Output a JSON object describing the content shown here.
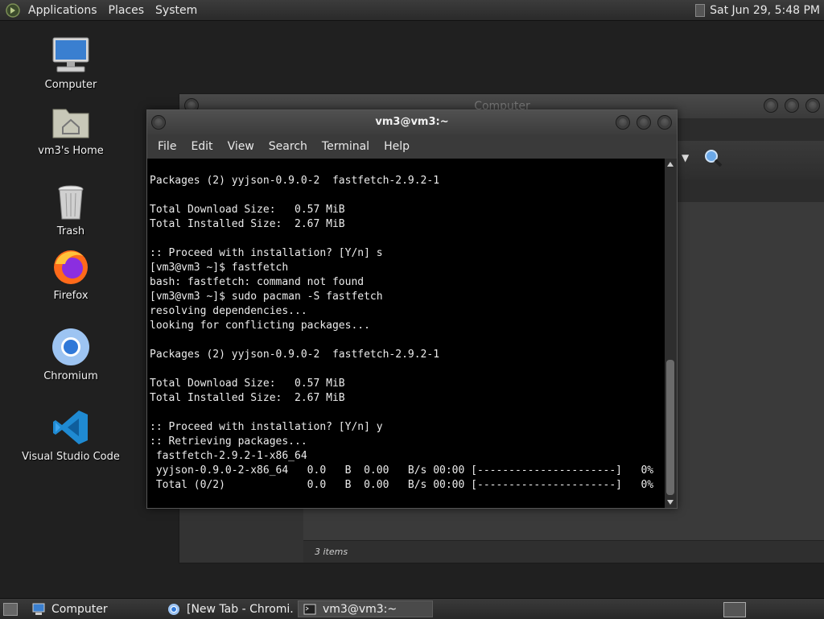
{
  "top_panel": {
    "menus": [
      "Applications",
      "Places",
      "System"
    ],
    "clock": "Sat Jun 29,  5:48 PM"
  },
  "desktop_icons": [
    {
      "label": "Computer",
      "icon": "computer-icon"
    },
    {
      "label": "vm3's Home",
      "icon": "home-folder-icon"
    },
    {
      "label": "Trash",
      "icon": "trash-icon"
    },
    {
      "label": "Firefox",
      "icon": "firefox-icon"
    },
    {
      "label": "Chromium",
      "icon": "chromium-icon"
    },
    {
      "label": "Visual Studio Code",
      "icon": "vscode-icon"
    }
  ],
  "file_manager": {
    "title": "Computer",
    "status": "3 items"
  },
  "terminal": {
    "title": "vm3@vm3:~",
    "menu": [
      "File",
      "Edit",
      "View",
      "Search",
      "Terminal",
      "Help"
    ],
    "lines": [
      "Packages (2) yyjson-0.9.0-2  fastfetch-2.9.2-1",
      "",
      "Total Download Size:   0.57 MiB",
      "Total Installed Size:  2.67 MiB",
      "",
      ":: Proceed with installation? [Y/n] s",
      "[vm3@vm3 ~]$ fastfetch",
      "bash: fastfetch: command not found",
      "[vm3@vm3 ~]$ sudo pacman -S fastfetch",
      "resolving dependencies...",
      "looking for conflicting packages...",
      "",
      "Packages (2) yyjson-0.9.0-2  fastfetch-2.9.2-1",
      "",
      "Total Download Size:   0.57 MiB",
      "Total Installed Size:  2.67 MiB",
      "",
      ":: Proceed with installation? [Y/n] y",
      ":: Retrieving packages...",
      " fastfetch-2.9.2-1-x86_64",
      " yyjson-0.9.0-2-x86_64   0.0   B  0.00   B/s 00:00 [----------------------]   0%",
      " Total (0/2)             0.0   B  0.00   B/s 00:00 [----------------------]   0%"
    ]
  },
  "taskbar": {
    "items": [
      {
        "label": "Computer",
        "icon": "computer-icon"
      },
      {
        "label": "[New Tab - Chromi...",
        "icon": "chromium-icon"
      },
      {
        "label": "vm3@vm3:~",
        "icon": "terminal-icon"
      }
    ]
  },
  "colors": {
    "desktop_bg": "#202020",
    "panel_bg": "#333333",
    "terminal_bg": "#000000",
    "terminal_fg": "#ececec"
  }
}
